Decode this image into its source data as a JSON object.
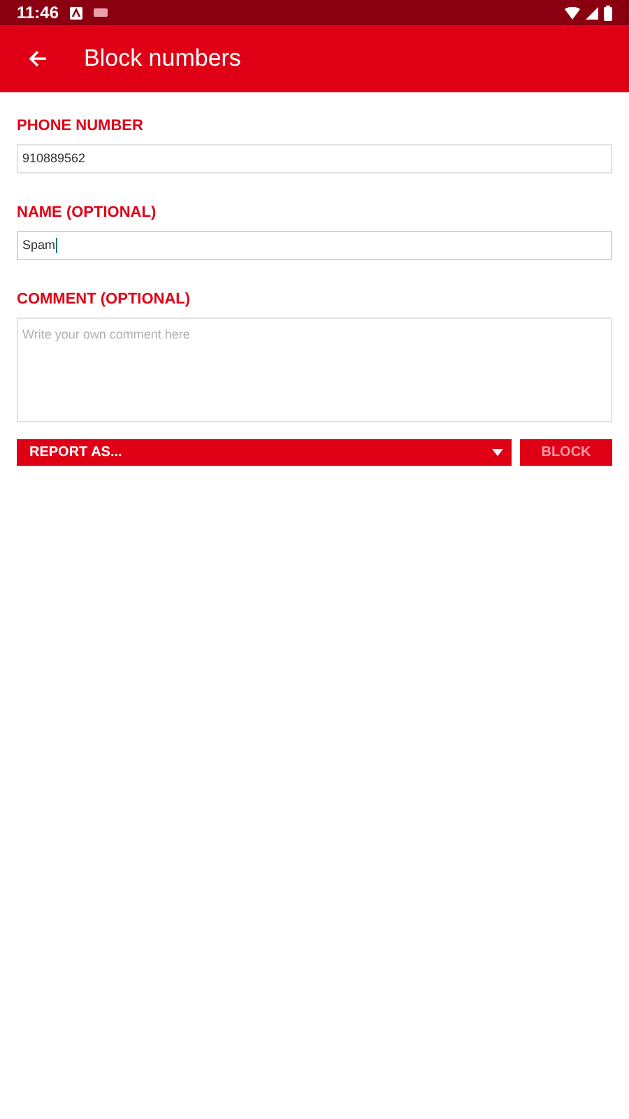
{
  "status_bar": {
    "time": "11:46"
  },
  "app_bar": {
    "title": "Block numbers"
  },
  "fields": [
    {
      "label": "PHONE NUMBER",
      "kind": "line",
      "value": "910889562",
      "focused": false
    },
    {
      "label": "NAME (OPTIONAL)",
      "kind": "line",
      "value": "Spam",
      "focused": true
    },
    {
      "label": "COMMENT (OPTIONAL)",
      "kind": "area",
      "placeholder": "Write your own comment here",
      "focused": false
    }
  ],
  "report_dropdown": {
    "label": "REPORT AS..."
  },
  "block_button": {
    "label": "BLOCK",
    "disabled": true
  }
}
